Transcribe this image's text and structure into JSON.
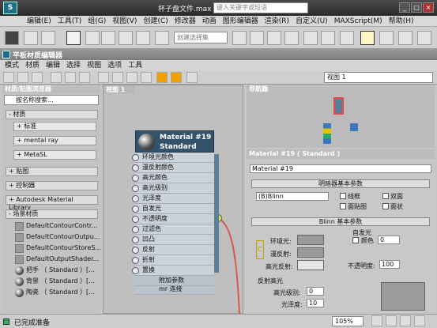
{
  "title": {
    "app_logo": "S",
    "file": "杯子盘文件.max",
    "search_placeholder": "键入关键字或短语",
    "buttons": [
      "_",
      "□",
      "×"
    ]
  },
  "main_menu": [
    "编辑(E)",
    "工具(T)",
    "组(G)",
    "视图(V)",
    "创建(C)",
    "修改器",
    "动画",
    "图形编辑器",
    "渲染(R)",
    "自定义(U)",
    "MAXScript(M)",
    "帮助(H)"
  ],
  "main_toolbar": {
    "selection_set_placeholder": "创建选择集"
  },
  "sme": {
    "title": "平板材质编辑器",
    "menu": [
      "模式",
      "材质",
      "编辑",
      "选择",
      "视图",
      "选项",
      "工具"
    ],
    "view_select": "视图 1",
    "browser": {
      "header": "材质/贴图浏览器",
      "search": "按名称搜索...",
      "groups": [
        {
          "label": "- 材质"
        },
        {
          "label": "+ 标准",
          "sub": true
        },
        {
          "label": "+ mental ray",
          "sub": true
        },
        {
          "label": "+ MetaSL",
          "sub": true
        },
        {
          "label": "+ 贴图"
        },
        {
          "label": "+ 控制器"
        },
        {
          "label": "+ Autodesk Material Library"
        },
        {
          "label": "- 场景材质"
        }
      ],
      "scene_materials": [
        {
          "name": "DefaultContourContr...",
          "type": "swatch"
        },
        {
          "name": "DefaultContourOutpu...",
          "type": "swatch"
        },
        {
          "name": "DefaultContourStoreS...",
          "type": "swatch"
        },
        {
          "name": "DefaultOutputShader...",
          "type": "swatch"
        },
        {
          "name": "把手 （ Standard ）[...",
          "type": "ball"
        },
        {
          "name": "背景 （ Standard ）[...",
          "type": "ball"
        },
        {
          "name": "陶瓷 （ Standard ）[...",
          "type": "ball"
        }
      ]
    },
    "view_tab": "视图 1",
    "node": {
      "name": "Material #19",
      "type": "Standard",
      "slots": [
        "环境光颜色",
        "漫反射颜色",
        "高光颜色",
        "高光级别",
        "光泽度",
        "自发光",
        "不透明度",
        "过滤色",
        "凹凸",
        "反射",
        "折射",
        "置换"
      ],
      "footer1": "附加参数",
      "footer2": "mr 连接"
    },
    "navigator": {
      "header": "导航器"
    },
    "params": {
      "header": "Material #19  ( Standard )",
      "name_field": "Material #19",
      "rollout1": "明暗器基本参数",
      "shader": "(B)Blinn",
      "checks": [
        "线框",
        "双面",
        "面贴图",
        "面状"
      ],
      "rollout2": "Blinn 基本参数",
      "self_illum_group": "自发光",
      "color_label": "颜色",
      "self_illum_value": "0",
      "ambient_label": "环境光:",
      "diffuse_label": "漫反射:",
      "specular_label": "高光反射:",
      "opacity_label": "不透明度:",
      "opacity_value": "100",
      "spec_group": "反射高光",
      "spec_level_label": "高光级别:",
      "spec_level_value": "0",
      "gloss_label": "光泽度:",
      "gloss_value": "10",
      "lock_glyph": "C"
    }
  },
  "status": {
    "text": "已完成准备",
    "zoom": "105%"
  },
  "colors": {
    "node_header": "#33526b",
    "wire": "#d95a4a",
    "accent": "#f0a000"
  }
}
